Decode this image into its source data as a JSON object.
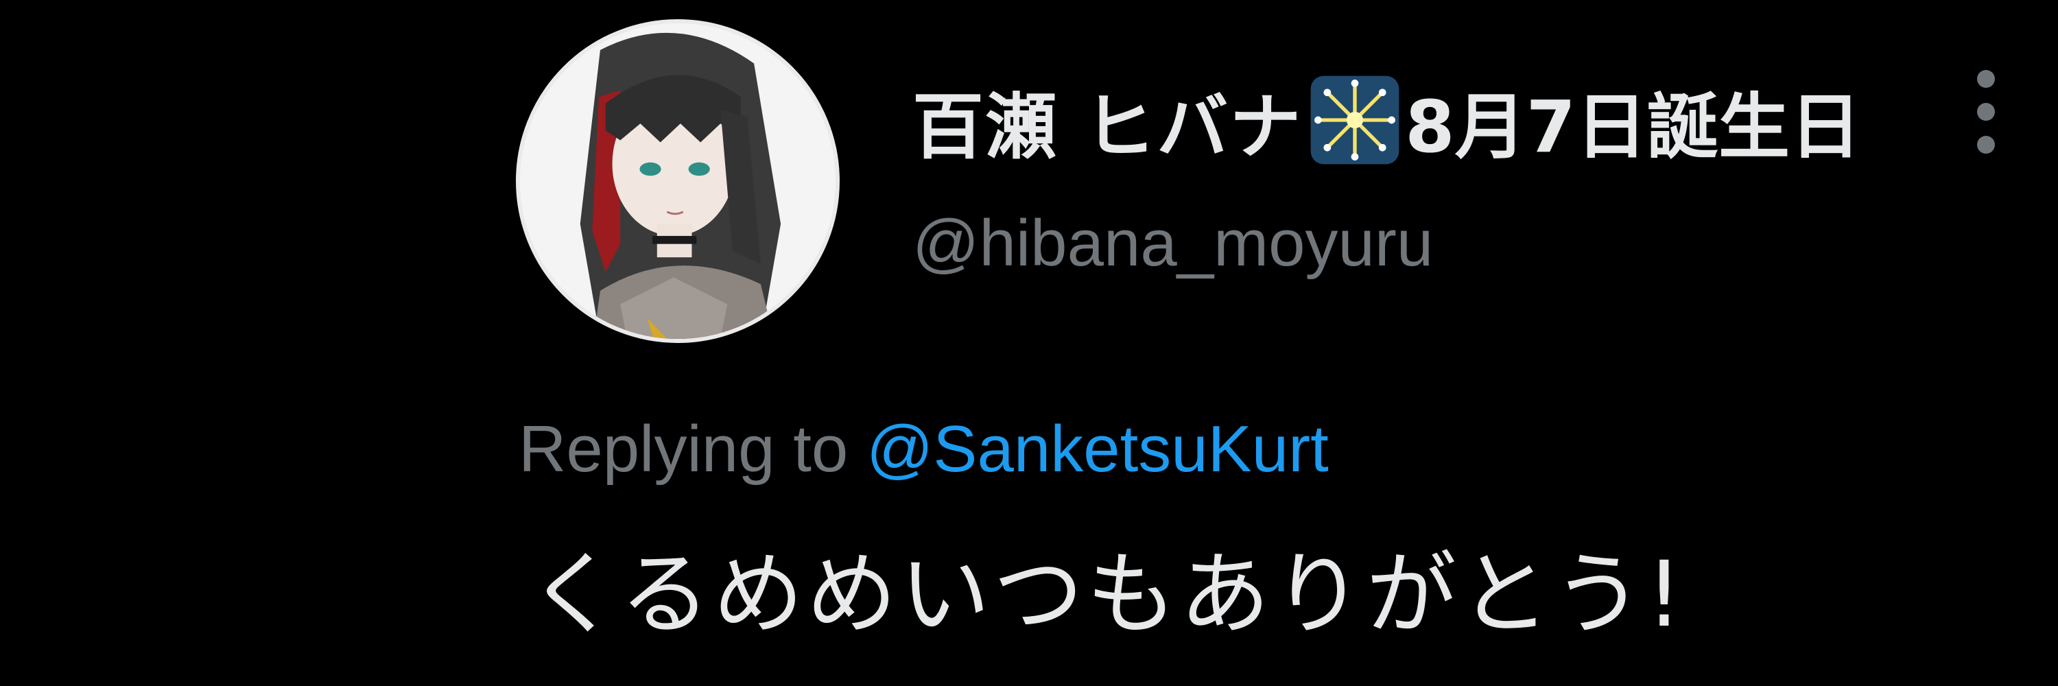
{
  "tweet": {
    "author": {
      "display_name": "百瀬 ヒバナ",
      "name_emoji": "sparkler-fireworks-icon",
      "name_suffix": "8月7日誕生日",
      "handle": "@hibana_moyuru",
      "avatar_icon": "anime-girl-avatar"
    },
    "reply": {
      "prefix": "Replying to ",
      "mention": "@SanketsuKurt"
    },
    "text": "くるめめいつもありがとう!",
    "menu_icon": "more-options-icon"
  },
  "colors": {
    "background": "#000000",
    "primary_text": "#e7e9ea",
    "secondary_text": "#71767b",
    "link": "#1d9bf0"
  }
}
